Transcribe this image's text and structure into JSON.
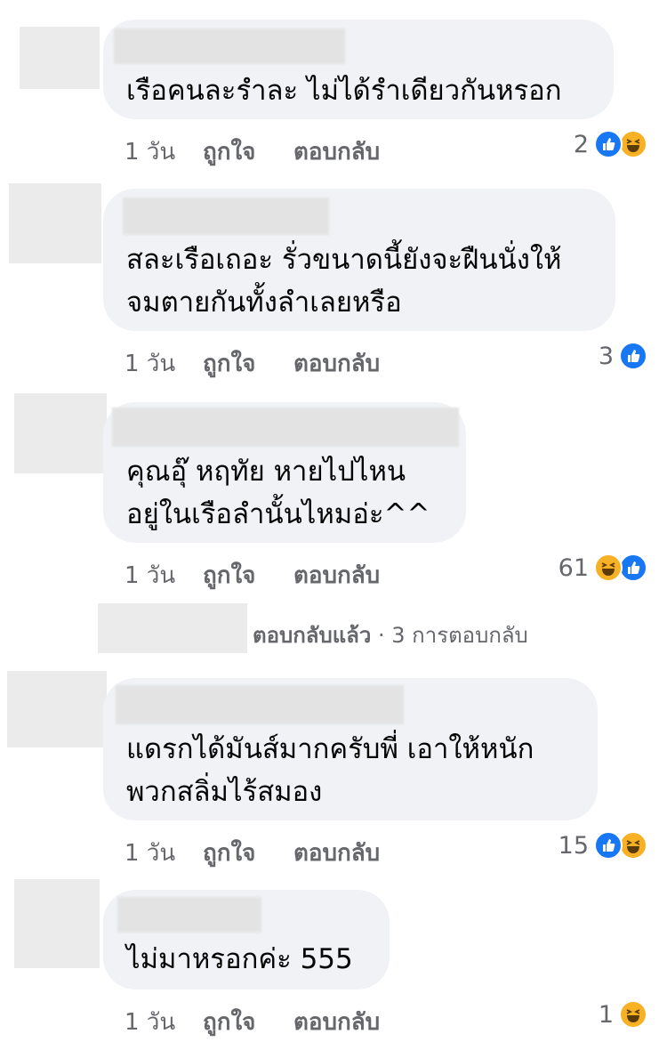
{
  "comments": [
    {
      "text": "เรือคนละรำละ ไม่ได้รำเดียวกันหรอก",
      "time": "1 วัน",
      "like": "ถูกใจ",
      "reply": "ตอบกลับ",
      "reactions": "2",
      "reaction_icons": [
        "like-icon",
        "haha-icon"
      ]
    },
    {
      "text_line1": "สละเรือเถอะ รั่วขนาดนี้ยังจะฝืนนั่งให้",
      "text_line2": "จมตายกันทั้งลำเลยหรือ",
      "time": "1 วัน",
      "like": "ถูกใจ",
      "reply": "ตอบกลับ",
      "reactions": "3",
      "reaction_icons": [
        "like-icon"
      ]
    },
    {
      "text_line1": "คุณอุ๊ หฤทัย  หายไปไหน",
      "text_line2": "อยู่ในเรือลำนั้นไหมอ่ะ^^",
      "time": "1 วัน",
      "like": "ถูกใจ",
      "reply": "ตอบกลับ",
      "reactions": "61",
      "reaction_icons": [
        "haha-icon",
        "like-icon"
      ]
    },
    {
      "text_line1": "แดรกได้มันส์มากครับพี่ เอาให้หนัก",
      "text_line2": "พวกสลิ่มไร้สมอง",
      "time": "1 วัน",
      "like": "ถูกใจ",
      "reply": "ตอบกลับ",
      "reactions": "15",
      "reaction_icons": [
        "like-icon",
        "haha-icon"
      ]
    },
    {
      "text": "ไม่มาหรอกค่ะ 555",
      "time": "1 วัน",
      "like": "ถูกใจ",
      "reply": "ตอบกลับ",
      "reactions": "1",
      "reaction_icons": [
        "haha-icon"
      ]
    }
  ],
  "replies_summary": {
    "label": "ตอบกลับแล้ว",
    "separator": "·",
    "count_text": "3 การตอบกลับ"
  },
  "colors": {
    "bubble": "#f0f2f5",
    "meta": "#65676b",
    "like": "#1877f2",
    "haha": "#f7b125"
  }
}
